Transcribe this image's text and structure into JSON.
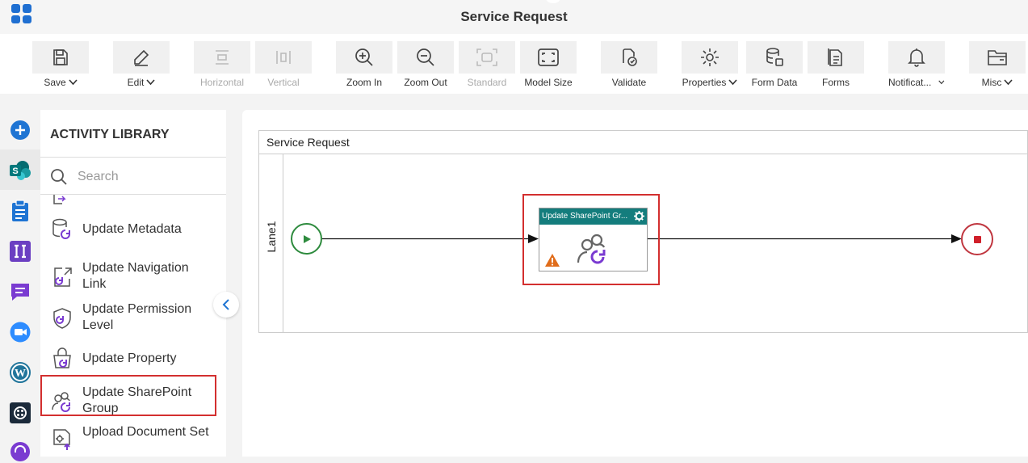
{
  "app": {
    "title": "Service Request",
    "brand_color": "#1f6fd1"
  },
  "toolbar": {
    "items": [
      {
        "label": "Save",
        "icon": "save-icon",
        "dropdown": true,
        "enabled": true
      },
      {
        "label": "Edit",
        "icon": "edit-icon",
        "dropdown": true,
        "enabled": true
      },
      {
        "label": "Horizontal",
        "icon": "horizontal-layout-icon",
        "dropdown": false,
        "enabled": false
      },
      {
        "label": "Vertical",
        "icon": "vertical-layout-icon",
        "dropdown": false,
        "enabled": false
      },
      {
        "label": "Zoom In",
        "icon": "zoom-in-icon",
        "dropdown": false,
        "enabled": true
      },
      {
        "label": "Zoom Out",
        "icon": "zoom-out-icon",
        "dropdown": false,
        "enabled": true
      },
      {
        "label": "Standard",
        "icon": "standard-size-icon",
        "dropdown": false,
        "enabled": false
      },
      {
        "label": "Model Size",
        "icon": "model-size-icon",
        "dropdown": false,
        "enabled": true
      },
      {
        "label": "Validate",
        "icon": "validate-icon",
        "dropdown": false,
        "enabled": true
      },
      {
        "label": "Properties",
        "icon": "properties-gear-icon",
        "dropdown": true,
        "enabled": true
      },
      {
        "label": "Form Data",
        "icon": "form-data-icon",
        "dropdown": false,
        "enabled": true
      },
      {
        "label": "Forms",
        "icon": "forms-icon",
        "dropdown": false,
        "enabled": true
      },
      {
        "label": "Notificat...",
        "icon": "notification-bell-icon",
        "dropdown": true,
        "enabled": true
      },
      {
        "label": "Misc",
        "icon": "misc-folder-icon",
        "dropdown": true,
        "enabled": true
      }
    ]
  },
  "rail": {
    "icons": [
      "add-icon",
      "sharepoint-icon",
      "clipboard-icon",
      "ii-app-icon",
      "chat-icon",
      "zoom-video-icon",
      "wordpress-icon",
      "grid-app-icon",
      "support-icon"
    ]
  },
  "library": {
    "title": "ACTIVITY LIBRARY",
    "search_placeholder": "Search",
    "items": [
      {
        "label": "Update Metadata",
        "icon": "update-metadata-icon"
      },
      {
        "label": "Update Navigation Link",
        "icon": "update-navigation-link-icon"
      },
      {
        "label": "Update Permission Level",
        "icon": "update-permission-level-icon"
      },
      {
        "label": "Update Property",
        "icon": "update-property-icon"
      },
      {
        "label": "Update SharePoint Group",
        "icon": "update-sharepoint-group-icon",
        "highlighted": true
      },
      {
        "label": "Upload Document Set",
        "icon": "upload-document-set-icon"
      }
    ]
  },
  "canvas": {
    "pool_title": "Service Request",
    "lane_label": "Lane1",
    "activity": {
      "title": "Update SharePoint Gr...",
      "header_color": "#147d7d",
      "has_warning": true
    },
    "start_color": "#2e8b3e",
    "end_color": "#c0363f",
    "highlight_color": "#d32f2f"
  }
}
